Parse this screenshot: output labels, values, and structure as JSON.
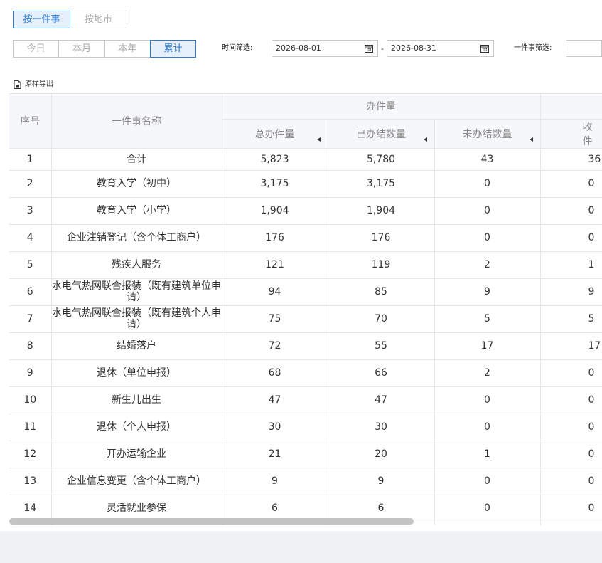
{
  "view_tabs": {
    "by_item": "按一件事",
    "by_city": "按地市"
  },
  "period_tabs": [
    "今日",
    "本月",
    "本年",
    "累计"
  ],
  "time_filter": {
    "label": "时间筛选:",
    "start": "2026-08-01",
    "end": "2026-08-31",
    "separator": "-"
  },
  "item_filter": {
    "label": "一件事筛选:"
  },
  "export": {
    "label": "原样导出"
  },
  "table": {
    "headers": {
      "seq": "序号",
      "name": "一件事名称",
      "group": "办件量",
      "total": "总办件量",
      "done": "已办结数量",
      "undone": "未办结数量",
      "received": "收件"
    },
    "rows": [
      [
        "1",
        "合计",
        "5,823",
        "5,780",
        "43",
        "36"
      ],
      [
        "2",
        "教育入学（初中）",
        "3,175",
        "3,175",
        "0",
        "0"
      ],
      [
        "3",
        "教育入学（小学）",
        "1,904",
        "1,904",
        "0",
        "0"
      ],
      [
        "4",
        "企业注销登记（含个体工商户）",
        "176",
        "176",
        "0",
        "0"
      ],
      [
        "5",
        "残疾人服务",
        "121",
        "119",
        "2",
        "1"
      ],
      [
        "6",
        "水电气热网联合报装（既有建筑单位申请）",
        "94",
        "85",
        "9",
        "9"
      ],
      [
        "7",
        "水电气热网联合报装（既有建筑个人申请）",
        "75",
        "70",
        "5",
        "5"
      ],
      [
        "8",
        "结婚落户",
        "72",
        "55",
        "17",
        "17"
      ],
      [
        "9",
        "退休（单位申报）",
        "68",
        "66",
        "2",
        "0"
      ],
      [
        "10",
        "新生儿出生",
        "47",
        "47",
        "0",
        "0"
      ],
      [
        "11",
        "退休（个人申报）",
        "30",
        "30",
        "0",
        "0"
      ],
      [
        "12",
        "开办运输企业",
        "21",
        "20",
        "1",
        "0"
      ],
      [
        "13",
        "企业信息变更（含个体工商户）",
        "9",
        "9",
        "0",
        "0"
      ],
      [
        "14",
        "灵活就业参保",
        "6",
        "6",
        "0",
        "0"
      ]
    ]
  }
}
